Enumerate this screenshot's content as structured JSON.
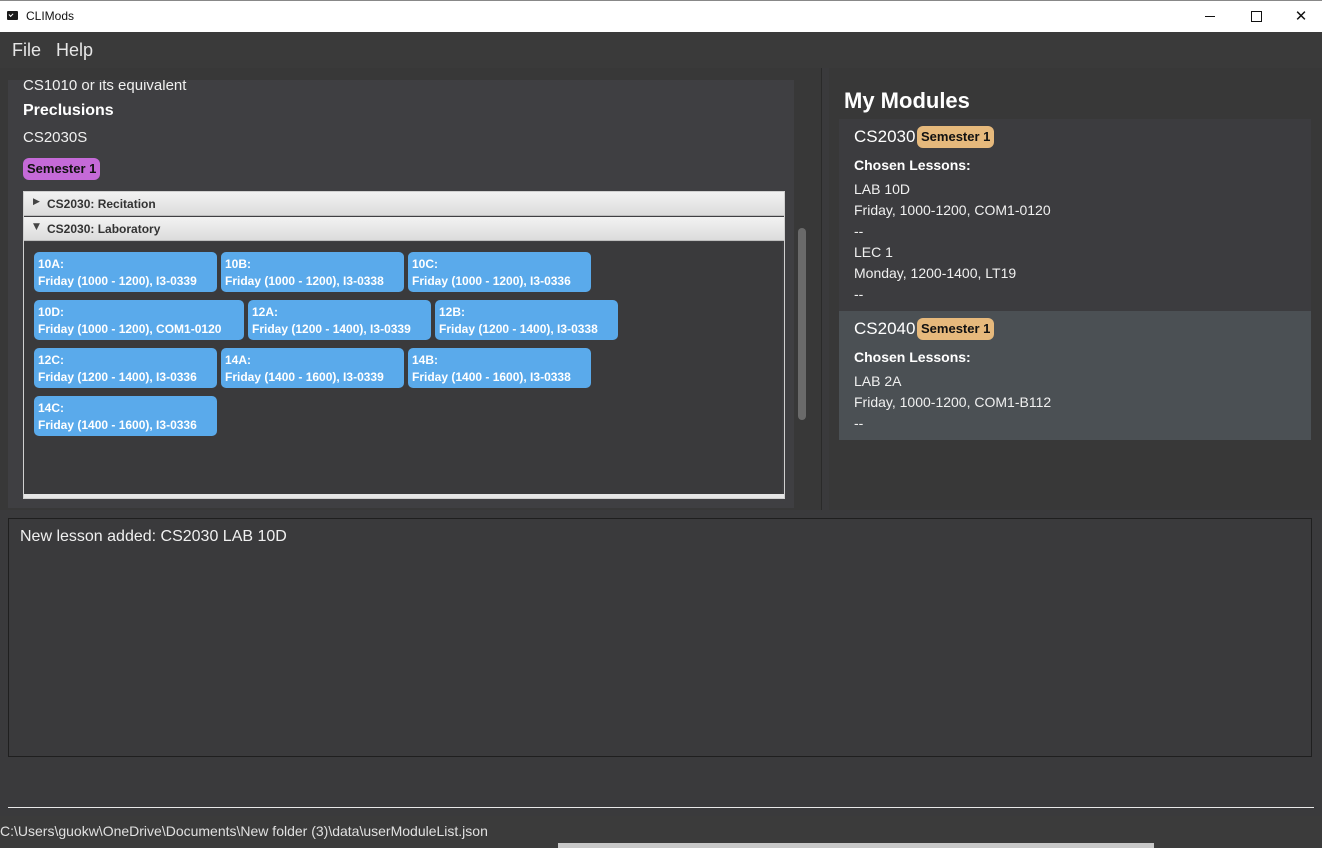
{
  "window": {
    "title": "CLIMods",
    "minimize_glyph": "",
    "maximize_glyph": "",
    "close_glyph": "✕"
  },
  "menu": {
    "file": "File",
    "help": "Help"
  },
  "module_detail": {
    "prerequisite_text": "CS1010 or its equivalent",
    "preclusions_heading": "Preclusions",
    "preclusions_text": "CS2030S",
    "semester_badge": "Semester 1",
    "lesson_groups": [
      {
        "label": "CS2030: Recitation",
        "expanded": false,
        "arrow": "▶"
      },
      {
        "label": "CS2030: Laboratory",
        "expanded": true,
        "arrow": "▼"
      }
    ],
    "lab_lessons": [
      {
        "code": "10A:",
        "detail": "Friday (1000 - 1200), I3-0339"
      },
      {
        "code": "10B:",
        "detail": "Friday (1000 - 1200), I3-0338"
      },
      {
        "code": "10C:",
        "detail": "Friday (1000 - 1200), I3-0336"
      },
      {
        "code": "10D:",
        "detail": "Friday (1000 - 1200), COM1-0120"
      },
      {
        "code": "12A:",
        "detail": "Friday (1200 - 1400), I3-0339"
      },
      {
        "code": "12B:",
        "detail": "Friday (1200 - 1400), I3-0338"
      },
      {
        "code": "12C:",
        "detail": "Friday (1200 - 1400), I3-0336"
      },
      {
        "code": "14A:",
        "detail": "Friday (1400 - 1600), I3-0339"
      },
      {
        "code": "14B:",
        "detail": "Friday (1400 - 1600), I3-0338"
      },
      {
        "code": "14C:",
        "detail": "Friday (1400 - 1600), I3-0336"
      }
    ]
  },
  "my_modules": {
    "title": "My Modules",
    "chosen_heading": "Chosen Lessons:",
    "modules": [
      {
        "code": "CS2030",
        "semester": "Semester 1",
        "lines": [
          "LAB 10D",
          "Friday, 1000-1200, COM1-0120",
          "--",
          "LEC 1",
          "Monday, 1200-1400, LT19",
          "--"
        ]
      },
      {
        "code": "CS2040",
        "semester": "Semester 1",
        "lines": [
          "LAB 2A",
          "Friday, 1000-1200, COM1-B112",
          "--"
        ]
      }
    ]
  },
  "result": {
    "message": "New lesson added: CS2030 LAB 10D"
  },
  "command": {
    "value": ""
  },
  "status": {
    "path": "C:\\Users\\guokw\\OneDrive\\Documents\\New folder (3)\\data\\userModuleList.json"
  }
}
